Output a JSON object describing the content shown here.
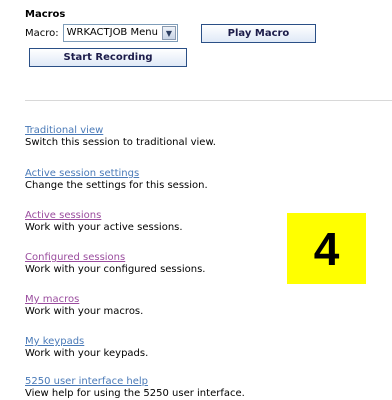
{
  "macros": {
    "title": "Macros",
    "macro_label": "Macro:",
    "selected_macro": "WRKACTJOB Menu",
    "play_label": "Play Macro",
    "record_label": "Start Recording"
  },
  "nav": [
    {
      "link": "Traditional view",
      "desc": "Switch this session to traditional view.",
      "link_color": "#4a7ab8"
    },
    {
      "link": "Active session settings",
      "desc": "Change the settings for this session.",
      "link_color": "#4a7ab8"
    },
    {
      "link": "Active sessions",
      "desc": "Work with your active sessions.",
      "link_color": "#9a4c9e"
    },
    {
      "link": "Configured sessions",
      "desc": "Work with your configured sessions.",
      "link_color": "#9a4c9e"
    },
    {
      "link": "My macros",
      "desc": "Work with your macros.",
      "link_color": "#9a4c9e"
    },
    {
      "link": "My keypads",
      "desc": "Work with your keypads.",
      "link_color": "#4a7ab8"
    },
    {
      "link": "5250 user interface help",
      "desc": "View help for using the 5250 user interface.",
      "link_color": "#4a7ab8"
    }
  ],
  "badge": {
    "text": "4",
    "color": "#ffff00"
  }
}
